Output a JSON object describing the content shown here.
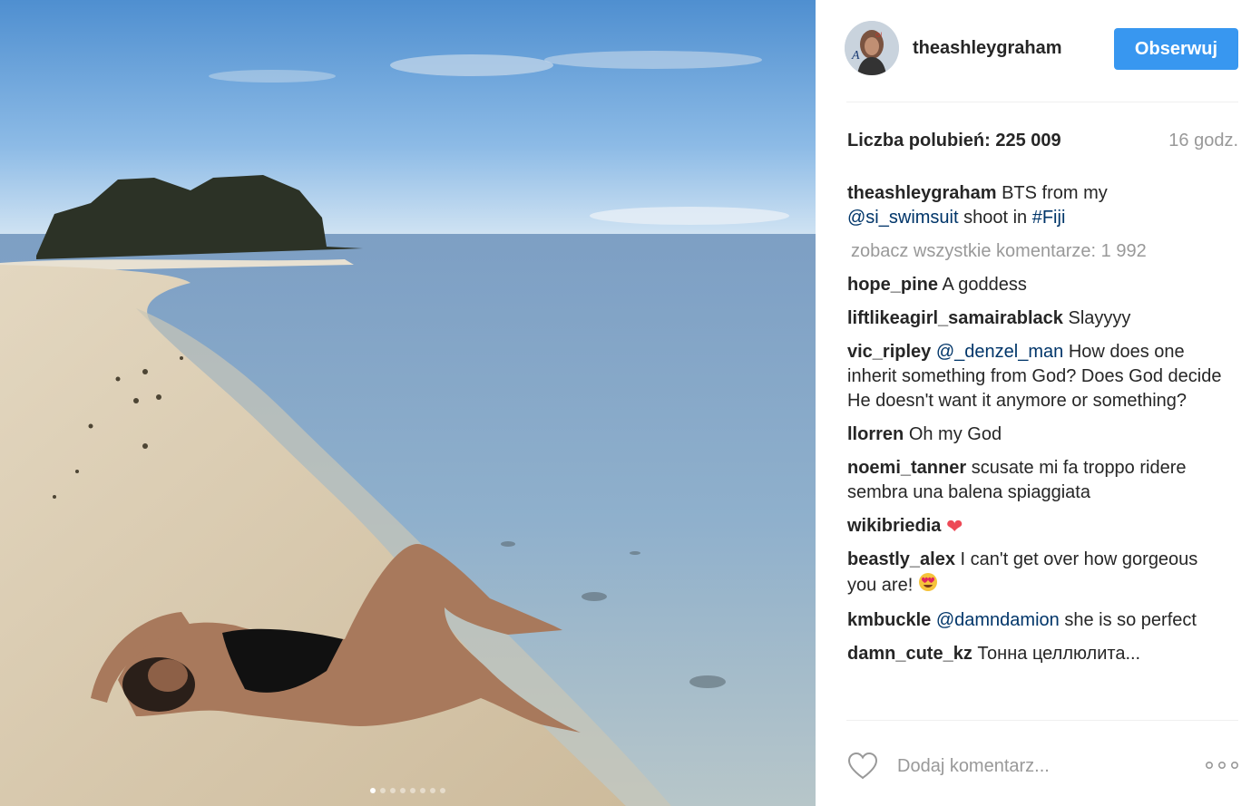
{
  "post": {
    "carousel": {
      "count": 8,
      "active": 0
    }
  },
  "header": {
    "username": "theashleygraham",
    "follow_label": "Obserwuj",
    "avatar_icon": "profile-avatar-image"
  },
  "stats": {
    "likes": "Liczba polubień: 225 009",
    "time": "16 godz."
  },
  "caption": {
    "username": "theashleygraham",
    "text_1": " BTS from my",
    "mention": "@si_swimsuit",
    "text_2": " shoot in ",
    "hashtag": "#Fiji"
  },
  "view_all": "zobacz wszystkie komentarze: 1 992",
  "comments": [
    {
      "user": "hope_pine",
      "text": "A goddess"
    },
    {
      "user": "liftlikeagirl_samairablack",
      "text": "Slayyyy"
    },
    {
      "user": "vic_ripley",
      "mention": "@_denzel_man",
      "text": "How does one inherit something from God? Does God decide He doesn't want it anymore or something?"
    },
    {
      "user": "llorren",
      "text": "Oh my God"
    },
    {
      "user": "noemi_tanner",
      "text": "scusate mi fa troppo ridere sembra una balena spiaggiata"
    },
    {
      "user": "wikibriedia",
      "emoji": "heart-emoji"
    },
    {
      "user": "beastly_alex",
      "text": "I can't get over how gorgeous you are!",
      "emoji": "heart-eyes-emoji"
    },
    {
      "user": "kmbuckle",
      "mention": "@damndamion",
      "text": "she is so perfect"
    },
    {
      "user": "damn_cute_kz",
      "text": "Тонна целлюлита..."
    }
  ],
  "footer": {
    "comment_placeholder": "Dodaj komentarz...",
    "like_icon": "heart-outline-icon",
    "more_icon": "more-options-icon"
  },
  "colors": {
    "follow_button": "#3897f0",
    "link": "#003569",
    "muted": "#999999",
    "heart": "#ed4956"
  }
}
